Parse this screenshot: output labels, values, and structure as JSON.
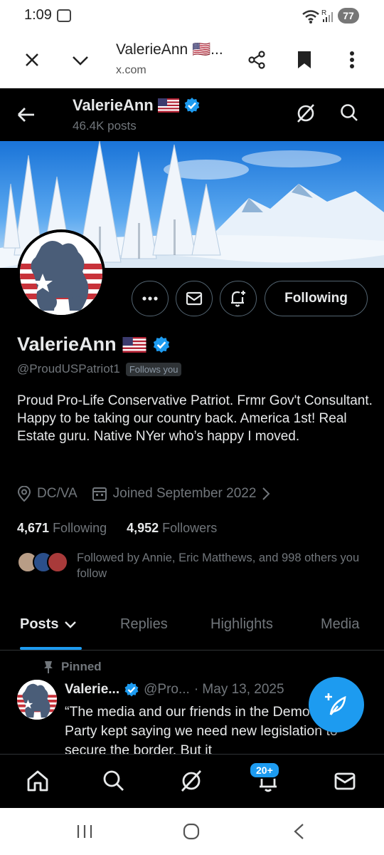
{
  "status_bar": {
    "time": "1:09",
    "battery": "77"
  },
  "browser": {
    "title": "ValerieAnn 🇺🇸...",
    "url": "x.com"
  },
  "header": {
    "name": "ValerieAnn",
    "posts_count": "46.4K posts"
  },
  "profile": {
    "name": "ValerieAnn",
    "handle": "@ProudUSPatriot1",
    "follows_you": "Follows you",
    "following_button": "Following",
    "bio": "Proud Pro-Life Conservative Patriot. Frmr Gov't Consultant. Happy to be taking our country back. America 1st! Real Estate guru. Native NYer who’s happy I moved.",
    "location": "DC/VA",
    "joined": "Joined September 2022",
    "following_count": "4,671",
    "following_label": "Following",
    "followers_count": "4,952",
    "followers_label": "Followers",
    "followed_by": "Followed by Annie, Eric Matthews, and 998 others you follow"
  },
  "tabs": [
    {
      "label": "Posts"
    },
    {
      "label": "Replies"
    },
    {
      "label": "Highlights"
    },
    {
      "label": "Media"
    }
  ],
  "post": {
    "pinned_label": "Pinned",
    "author": "Valerie...",
    "handle": "@Pro...",
    "date": "· May 13, 2025",
    "text": "“The media and our friends in the Democratic Party kept saying we need new legislation to secure the border. But it"
  },
  "bottom_nav": {
    "notifications_badge": "20+"
  },
  "colors": {
    "accent": "#1d9bf0",
    "background": "#000000",
    "muted": "#71767b"
  }
}
